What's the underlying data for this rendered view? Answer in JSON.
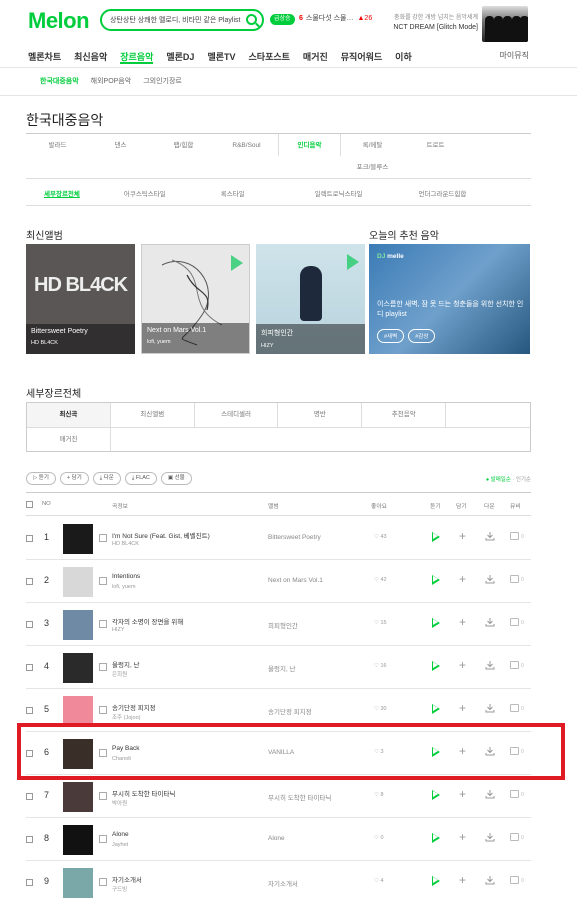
{
  "header": {
    "logo": "Melon",
    "search_value": "상탄상탄 상쾌한 멜로디, 비타민 같은 Playlist",
    "live_badge": "급상승",
    "chart_rank": "6",
    "chart_song": "스물다섯 스물…",
    "chart_change": "▲26",
    "promo_line1": "충화를 강한 개방 넘치는 음악세계",
    "promo_line2": "NCT DREAM [Glitch Mode]"
  },
  "gnb": {
    "items": [
      "멜론차트",
      "최신음악",
      "장르음악",
      "멜론DJ",
      "멜론TV",
      "스타포스트",
      "매거진",
      "뮤직어워드",
      "이하"
    ],
    "mymusic": "마이뮤직"
  },
  "subgnb": {
    "items": [
      "한국대중음악",
      "해외POP음악",
      "그외인기장르"
    ]
  },
  "page_title": "한국대중음악",
  "genres": {
    "row1": [
      "발라드",
      "댄스",
      "랩/힙합",
      "R&B/Soul",
      "인디음악",
      "록/메탈",
      "트로트",
      ""
    ],
    "row2": "포크/블루스",
    "sub": [
      "세부장르전체",
      "어쿠스틱스타일",
      "록스타일",
      "일렉트로닉스타일",
      "언더그라운드힙합"
    ]
  },
  "latest": {
    "title": "최신앨범",
    "albums": [
      {
        "title": "Bittersweet Poetry",
        "artist": "HD BL4CK",
        "art": "HD BL4CK"
      },
      {
        "title": "Next on Mars Vol.1",
        "artist": "lofi, yuem",
        "art": ""
      },
      {
        "title": "희피형인간",
        "artist": "HIZY",
        "art": ""
      }
    ]
  },
  "recommend": {
    "title": "오늘의 추천 음악",
    "dj_label": "DJ",
    "dj_name": "melle",
    "desc": "이스름한 새벽, 잠 못 드는 청춘들을 위한 선치한 인디 playlist",
    "tags": [
      "#새벽",
      "#감성"
    ]
  },
  "detail": {
    "title": "세부장르전체",
    "tabs_row1": [
      "최신곡",
      "최신앨범",
      "스테디셀러",
      "명반",
      "추천음악",
      ""
    ],
    "tabs_row2": [
      "매거진"
    ]
  },
  "toolbar": {
    "buttons": [
      "듣기",
      "담기",
      "다운",
      "FLAC",
      "선물"
    ],
    "sort_on": "발매일순",
    "sort_off": "인기순"
  },
  "table": {
    "headers": {
      "no": "NO",
      "song": "곡정보",
      "album": "앨범",
      "like": "좋아요",
      "listen": "듣기",
      "add": "담기",
      "down": "다운",
      "mv": "뮤비"
    },
    "rows": [
      {
        "rank": "1",
        "title": "I'm Not Sure (Feat. Gist, 베벨진트)",
        "artist": "HD BL4CK",
        "album": "Bittersweet Poetry",
        "likes": "43",
        "mv": "0",
        "color": "#1a1a1a"
      },
      {
        "rank": "2",
        "title": "Intentions",
        "artist": "lofi, yuem",
        "album": "Next on Mars Vol.1",
        "likes": "42",
        "mv": "0",
        "color": "#d8d8d8"
      },
      {
        "rank": "3",
        "title": "각자의 소명이 장면을 위해",
        "artist": "HIZY",
        "album": "희피형인간",
        "likes": "15",
        "mv": "0",
        "color": "#6e8aa5"
      },
      {
        "rank": "4",
        "title": "울렁지, 난",
        "artist": "은희원",
        "album": "울렁지, 난",
        "likes": "16",
        "mv": "0",
        "color": "#2a2a2a"
      },
      {
        "rank": "5",
        "title": "송기단정 피지정",
        "artist": "조주 (Jojoo)",
        "album": "송기단정 피지정",
        "likes": "30",
        "mv": "0",
        "color": "#f08a9a"
      },
      {
        "rank": "6",
        "title": "Pay Back",
        "artist": "Chanolt",
        "album": "VANILLA",
        "likes": "3",
        "mv": "0",
        "color": "#3a2e28"
      },
      {
        "rank": "7",
        "title": "무시히 도착한 타이타닉",
        "artist": "박아원",
        "album": "무시히 도착한 타이타닉",
        "likes": "8",
        "mv": "0",
        "color": "#4a3a3a"
      },
      {
        "rank": "8",
        "title": "Alone",
        "artist": "Jayhet",
        "album": "Alone",
        "likes": "0",
        "mv": "0",
        "color": "#111111"
      },
      {
        "rank": "9",
        "title": "자기소개서",
        "artist": "구드빙",
        "album": "자기소개서",
        "likes": "4",
        "mv": "0",
        "color": "#7aa8a8"
      }
    ]
  },
  "colors": {
    "accent": "#00cd3c",
    "highlight": "#e01b24"
  }
}
